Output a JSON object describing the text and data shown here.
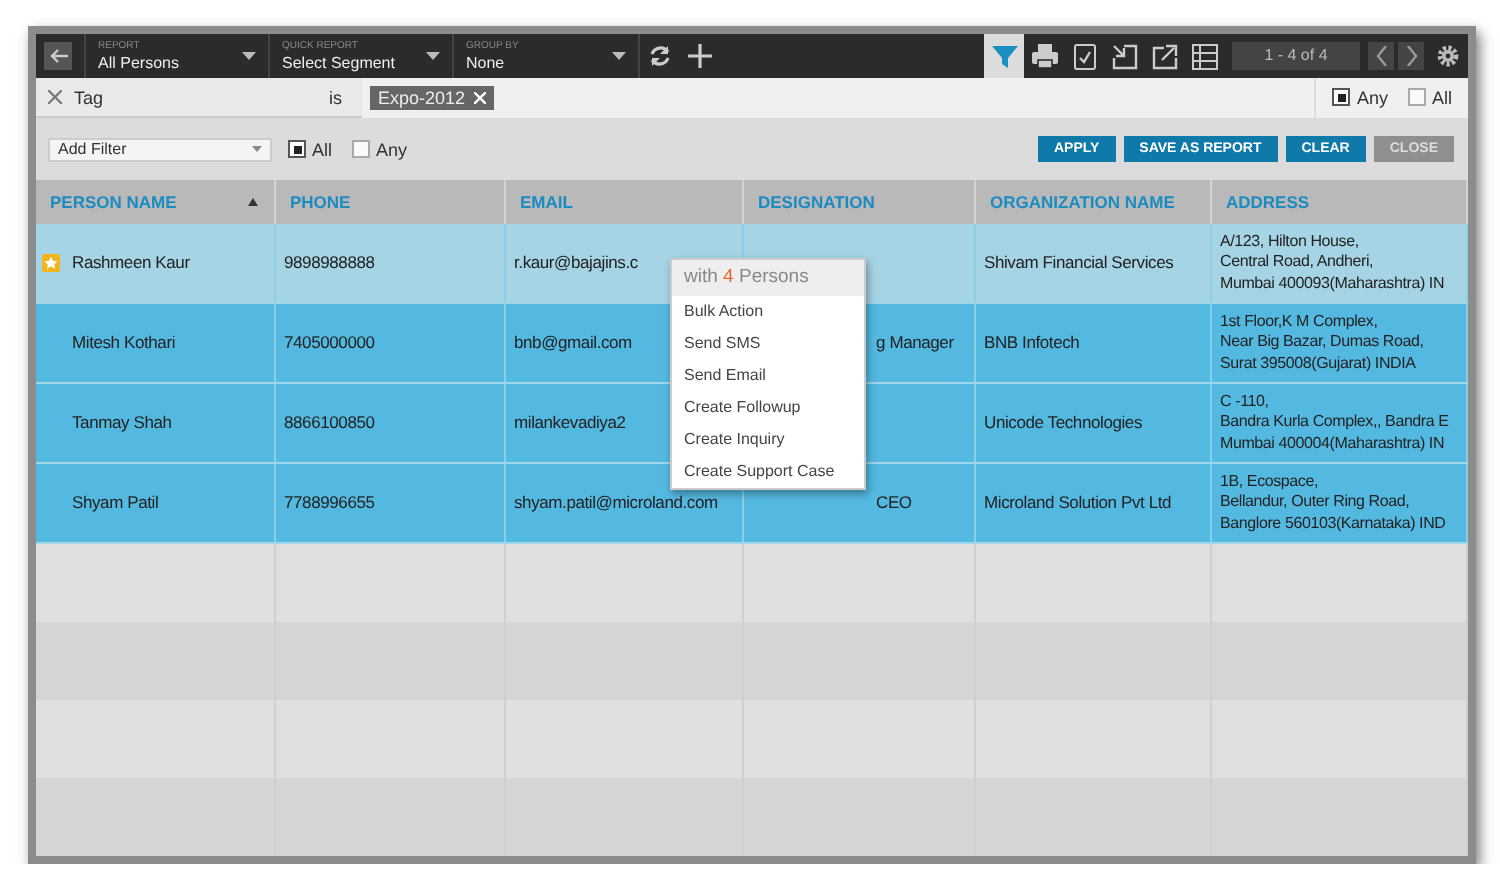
{
  "toolbar": {
    "selectors": [
      {
        "label": "REPORT",
        "value": "All Persons"
      },
      {
        "label": "QUICK REPORT",
        "value": "Select Segment"
      },
      {
        "label": "GROUP BY",
        "value": "None"
      }
    ],
    "tools": [
      {
        "kind": "filter",
        "selected": true
      },
      {
        "kind": "print",
        "selected": false
      },
      {
        "kind": "checklist",
        "selected": false
      },
      {
        "kind": "import",
        "selected": false
      },
      {
        "kind": "export",
        "selected": false
      },
      {
        "kind": "list",
        "selected": false
      }
    ],
    "pager": "1 - 4 of 4"
  },
  "filter_rule": {
    "field": "Tag",
    "operator": "is",
    "values": [
      "Expo-2012"
    ],
    "match": [
      {
        "label": "Any",
        "checked": true
      },
      {
        "label": "All",
        "checked": false
      }
    ]
  },
  "filter_actions": {
    "add_filter": {
      "value": "Add Filter"
    },
    "match": [
      {
        "label": "All",
        "checked": true
      },
      {
        "label": "Any",
        "checked": false
      }
    ],
    "buttons": [
      {
        "label": "APPLY",
        "disabled": false
      },
      {
        "label": "SAVE AS REPORT",
        "disabled": false
      },
      {
        "label": "CLEAR",
        "disabled": false
      },
      {
        "label": "CLOSE",
        "disabled": true
      }
    ]
  },
  "table": {
    "columns": [
      {
        "label": "PERSON NAME",
        "sorted_ascending": true
      },
      {
        "label": "PHONE"
      },
      {
        "label": "EMAIL"
      },
      {
        "label": "DESIGNATION"
      },
      {
        "label": "ORGANIZATION NAME"
      },
      {
        "label": "ADDRESS"
      }
    ],
    "rows": [
      {
        "starred": true,
        "highlighted": true,
        "selected": true,
        "cells": [
          "Rashmeen Kaur",
          "9898988888",
          "r.kaur@bajajins.c",
          "",
          "Shivam Financial Services",
          "A/123, Hilton House,\nCentral Road, Andheri,\nMumbai 400093(Maharashtra) IN"
        ]
      },
      {
        "starred": false,
        "highlighted": false,
        "selected": true,
        "cells": [
          "Mitesh Kothari",
          "7405000000",
          "bnb@gmail.com",
          "g Manager",
          "BNB Infotech",
          "1st Floor,K M Complex,\nNear Big Bazar, Dumas Road,\nSurat 395008(Gujarat) INDIA"
        ]
      },
      {
        "starred": false,
        "highlighted": false,
        "selected": true,
        "cells": [
          "Tanmay Shah",
          "8866100850",
          "milankevadiya2",
          "",
          "Unicode Technologies",
          "C -110,\nBandra Kurla Complex,, Bandra E\nMumbai 400004(Maharashtra) IN"
        ]
      },
      {
        "starred": false,
        "highlighted": false,
        "selected": true,
        "cells": [
          "Shyam Patil",
          "7788996655",
          "shyam.patil@microland.com",
          "CEO",
          "Microland Solution Pvt Ltd",
          "1B, Ecospace,\nBellandur, Outer Ring Road,\nBanglore 560103(Karnataka) IND"
        ]
      }
    ]
  },
  "context_menu": {
    "prefix": "with",
    "count": "4",
    "suffix": "Persons",
    "items": [
      "Bulk Action",
      "Send SMS",
      "Send Email",
      "Create Followup",
      "Create Inquiry",
      "Create Support Case"
    ]
  }
}
